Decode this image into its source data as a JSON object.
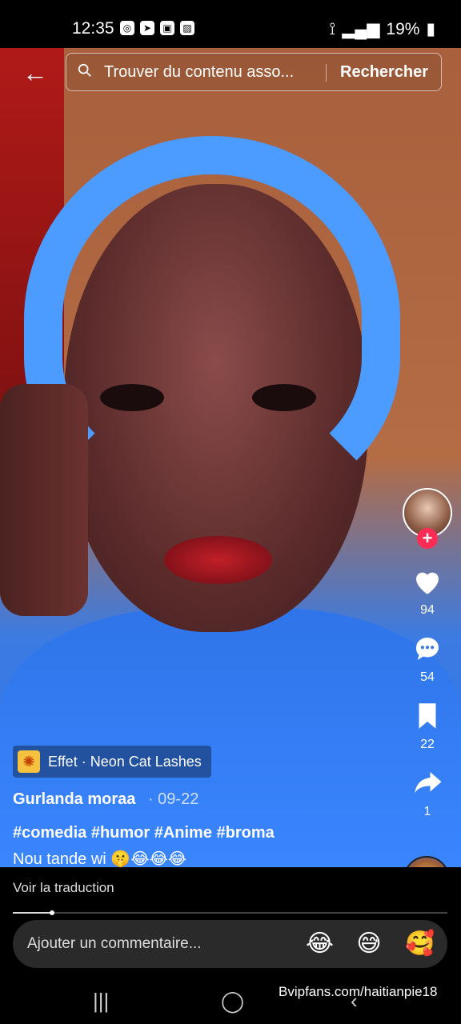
{
  "status": {
    "time": "12:35",
    "battery": "19%",
    "icons": [
      "whatsapp-icon",
      "telegram-icon",
      "app-icon",
      "gallery-icon"
    ]
  },
  "search": {
    "placeholder": "Trouver du contenu asso...",
    "button": "Rechercher"
  },
  "rail": {
    "likes": "94",
    "comments": "54",
    "saves": "22",
    "shares": "1"
  },
  "effect": {
    "label": "Effet · Neon Cat Lashes"
  },
  "post": {
    "author": "Gurlanda moraa",
    "date": "· 09-22",
    "hashtags": "#comedia #humor #Anime #broma",
    "caption": "Nou tande wi 🤫😂😂😂"
  },
  "bottom": {
    "translate": "Voir la traduction",
    "progress": 0.09,
    "comment_placeholder": "Ajouter un commentaire...",
    "emojis": [
      "😂",
      "😅",
      "🥰"
    ]
  },
  "watermark": "Bvipfans.com/haitianpie18"
}
